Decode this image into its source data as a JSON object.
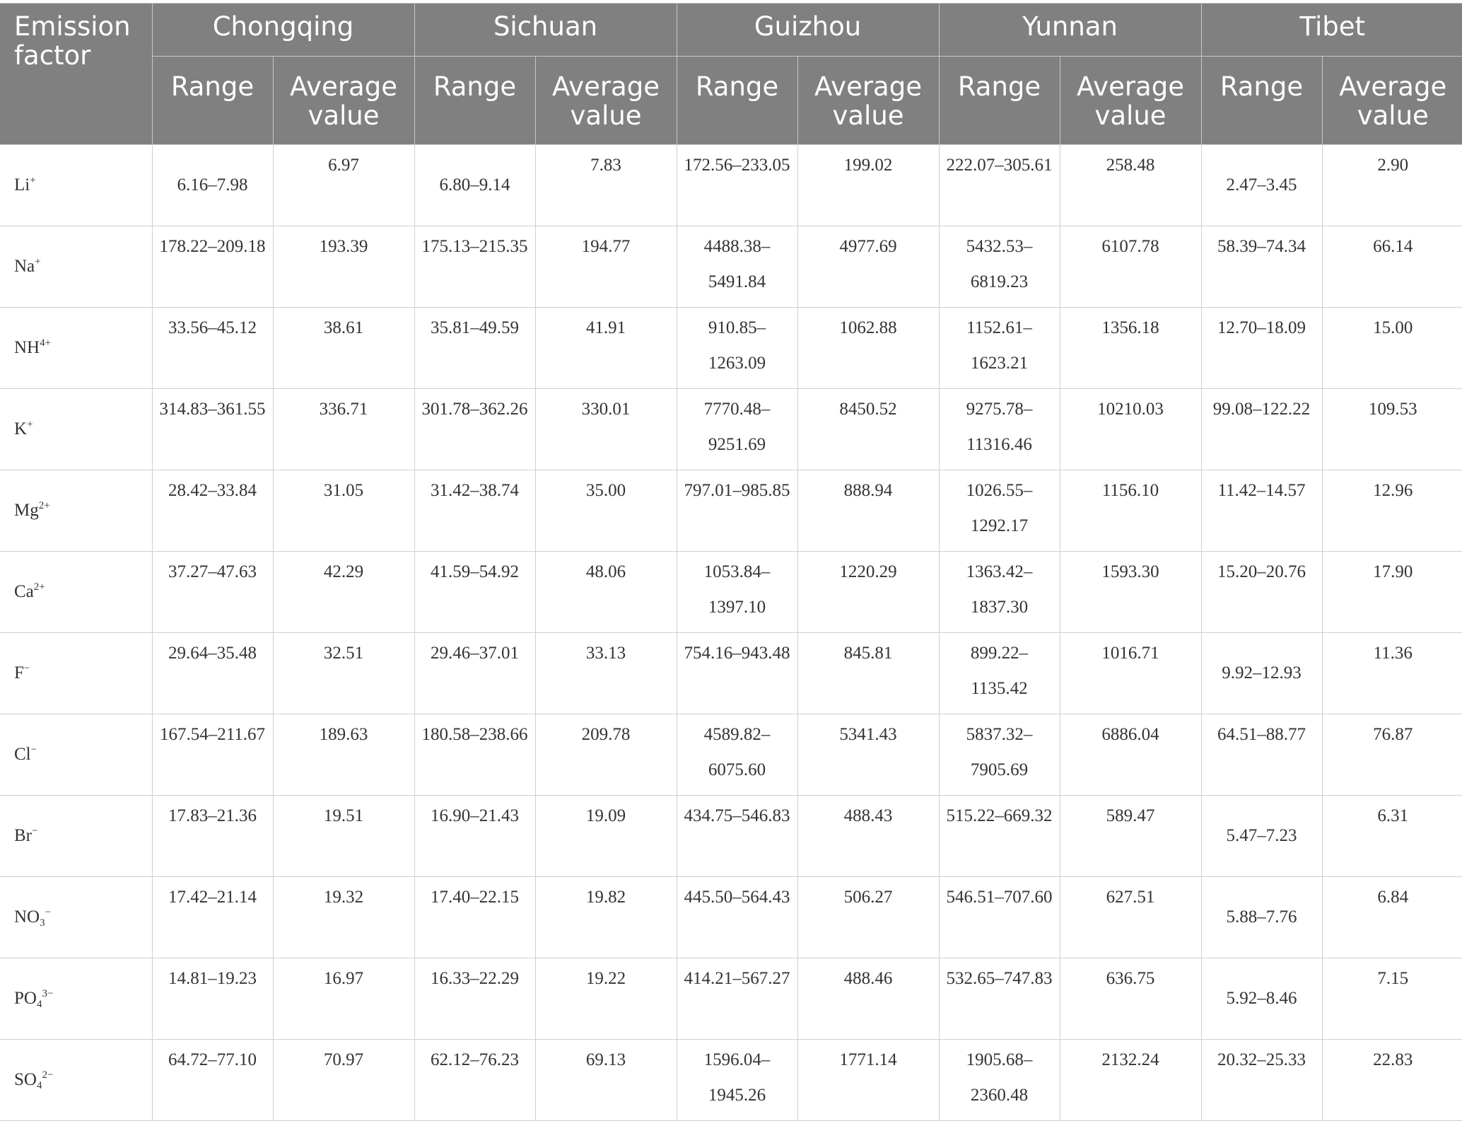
{
  "header": {
    "factor_label": "Emission factor",
    "regions": [
      "Chongqing",
      "Sichuan",
      "Guizhou",
      "Yunnan",
      "Tibet"
    ],
    "range_label": "Range",
    "average_label": "Average value"
  },
  "rows": [
    {
      "base": "Li",
      "sub": "",
      "sup": "+",
      "cells": [
        [
          "6.16–7.98",
          "6.97"
        ],
        [
          "6.80–9.14",
          "7.83"
        ],
        [
          "172.56–233.05",
          "199.02"
        ],
        [
          "222.07–305.61",
          "258.48"
        ],
        [
          "2.47–3.45",
          "2.90"
        ]
      ]
    },
    {
      "base": "Na",
      "sub": "",
      "sup": "+",
      "cells": [
        [
          "178.22–209.18",
          "193.39"
        ],
        [
          "175.13–215.35",
          "194.77"
        ],
        [
          "4488.38–5491.84",
          "4977.69"
        ],
        [
          "5432.53–6819.23",
          "6107.78"
        ],
        [
          "58.39–74.34",
          "66.14"
        ]
      ]
    },
    {
      "base": "NH",
      "sub": "",
      "sup": "4+",
      "cells": [
        [
          "33.56–45.12",
          "38.61"
        ],
        [
          "35.81–49.59",
          "41.91"
        ],
        [
          "910.85–1263.09",
          "1062.88"
        ],
        [
          "1152.61–1623.21",
          "1356.18"
        ],
        [
          "12.70–18.09",
          "15.00"
        ]
      ]
    },
    {
      "base": "K",
      "sub": "",
      "sup": "+",
      "cells": [
        [
          "314.83–361.55",
          "336.71"
        ],
        [
          "301.78–362.26",
          "330.01"
        ],
        [
          "7770.48–9251.69",
          "8450.52"
        ],
        [
          "9275.78–11316.46",
          "10210.03"
        ],
        [
          "99.08–122.22",
          "109.53"
        ]
      ]
    },
    {
      "base": "Mg",
      "sub": "",
      "sup": "2+",
      "cells": [
        [
          "28.42–33.84",
          "31.05"
        ],
        [
          "31.42–38.74",
          "35.00"
        ],
        [
          "797.01–985.85",
          "888.94"
        ],
        [
          "1026.55–1292.17",
          "1156.10"
        ],
        [
          "11.42–14.57",
          "12.96"
        ]
      ]
    },
    {
      "base": "Ca",
      "sub": "",
      "sup": "2+",
      "cells": [
        [
          "37.27–47.63",
          "42.29"
        ],
        [
          "41.59–54.92",
          "48.06"
        ],
        [
          "1053.84–1397.10",
          "1220.29"
        ],
        [
          "1363.42–1837.30",
          "1593.30"
        ],
        [
          "15.20–20.76",
          "17.90"
        ]
      ]
    },
    {
      "base": "F",
      "sub": "",
      "sup": "−",
      "cells": [
        [
          "29.64–35.48",
          "32.51"
        ],
        [
          "29.46–37.01",
          "33.13"
        ],
        [
          "754.16–943.48",
          "845.81"
        ],
        [
          "899.22–1135.42",
          "1016.71"
        ],
        [
          "9.92–12.93",
          "11.36"
        ]
      ]
    },
    {
      "base": "Cl",
      "sub": "",
      "sup": "−",
      "cells": [
        [
          "167.54–211.67",
          "189.63"
        ],
        [
          "180.58–238.66",
          "209.78"
        ],
        [
          "4589.82–6075.60",
          "5341.43"
        ],
        [
          "5837.32–7905.69",
          "6886.04"
        ],
        [
          "64.51–88.77",
          "76.87"
        ]
      ]
    },
    {
      "base": "Br",
      "sub": "",
      "sup": "−",
      "cells": [
        [
          "17.83–21.36",
          "19.51"
        ],
        [
          "16.90–21.43",
          "19.09"
        ],
        [
          "434.75–546.83",
          "488.43"
        ],
        [
          "515.22–669.32",
          "589.47"
        ],
        [
          "5.47–7.23",
          "6.31"
        ]
      ]
    },
    {
      "base": "NO",
      "sub": "3",
      "sup": "−",
      "cells": [
        [
          "17.42–21.14",
          "19.32"
        ],
        [
          "17.40–22.15",
          "19.82"
        ],
        [
          "445.50–564.43",
          "506.27"
        ],
        [
          "546.51–707.60",
          "627.51"
        ],
        [
          "5.88–7.76",
          "6.84"
        ]
      ]
    },
    {
      "base": "PO",
      "sub": "4",
      "sup": "3−",
      "cells": [
        [
          "14.81–19.23",
          "16.97"
        ],
        [
          "16.33–22.29",
          "19.22"
        ],
        [
          "414.21–567.27",
          "488.46"
        ],
        [
          "532.65–747.83",
          "636.75"
        ],
        [
          "5.92–8.46",
          "7.15"
        ]
      ]
    },
    {
      "base": "SO",
      "sub": "4",
      "sup": "2−",
      "cells": [
        [
          "64.72–77.10",
          "70.97"
        ],
        [
          "62.12–76.23",
          "69.13"
        ],
        [
          "1596.04–1945.26",
          "1771.14"
        ],
        [
          "1905.68–2360.48",
          "2132.24"
        ],
        [
          "20.32–25.33",
          "22.83"
        ]
      ]
    }
  ]
}
